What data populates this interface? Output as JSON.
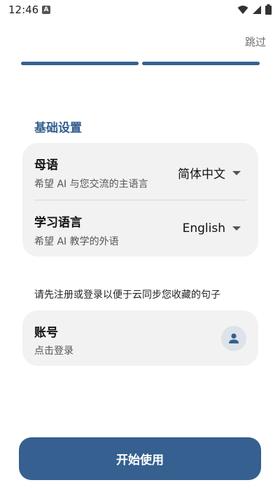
{
  "status_bar": {
    "time": "12:46",
    "notification_glyph": "A",
    "icons": [
      "wifi-icon",
      "signal-icon",
      "battery-icon"
    ]
  },
  "header": {
    "skip_label": "跳过",
    "progress": {
      "total_steps": 2,
      "completed_steps": 2
    }
  },
  "basic_settings": {
    "title": "基础设置",
    "native_language": {
      "title": "母语",
      "subtitle": "希望 AI 与您交流的主语言",
      "value": "简体中文"
    },
    "learning_language": {
      "title": "学习语言",
      "subtitle": "希望 AI 教学的外语",
      "value": "English"
    }
  },
  "account": {
    "hint": "请先注册或登录以便于云同步您收藏的句子",
    "title": "账号",
    "subtitle": "点击登录"
  },
  "start_button_label": "开始使用",
  "colors": {
    "accent": "#35608f",
    "card_background": "#f2f2f2",
    "avatar_background": "#dde3ea"
  }
}
